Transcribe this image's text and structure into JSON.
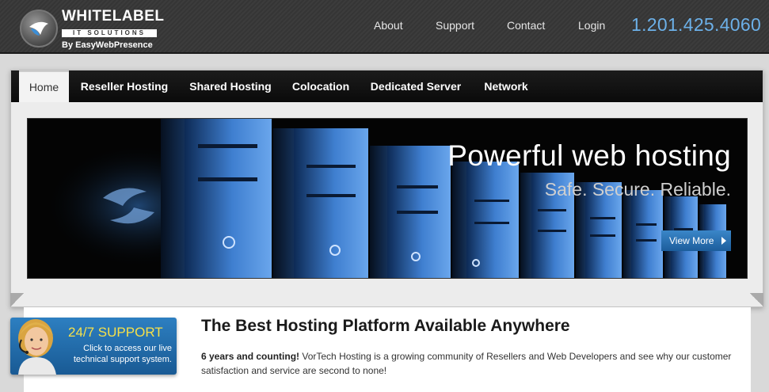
{
  "header": {
    "logo": {
      "main": "WHITELABEL",
      "sub": "IT SOLUTIONS",
      "by": "By EasyWebPresence"
    },
    "links": [
      {
        "label": "About"
      },
      {
        "label": "Support"
      },
      {
        "label": "Contact"
      },
      {
        "label": "Login"
      }
    ],
    "phone": "1.201.425.4060"
  },
  "nav": {
    "items": [
      {
        "label": "Home",
        "active": true
      },
      {
        "label": "Reseller Hosting",
        "active": false
      },
      {
        "label": "Shared Hosting",
        "active": false
      },
      {
        "label": "Colocation",
        "active": false
      },
      {
        "label": "Dedicated Server",
        "active": false
      },
      {
        "label": "Network",
        "active": false
      }
    ]
  },
  "hero": {
    "title": "Powerful web hosting",
    "subtitle": "Safe. Secure. Reliable.",
    "button_label": "View More"
  },
  "support": {
    "title": "24/7 SUPPORT",
    "text": "Click to access our live technical support system."
  },
  "content": {
    "title": "The Best Hosting Platform Available Anywhere",
    "lead": "6 years and counting!",
    "body": "VorTech Hosting is a growing community of Resellers and Web Developers and see why our customer satisfaction and service are second to none!"
  },
  "colors": {
    "accent_blue": "#2d7fc1",
    "phone_blue": "#6cb0e8",
    "support_yellow": "#f6e04a",
    "nav_black": "#111111"
  }
}
